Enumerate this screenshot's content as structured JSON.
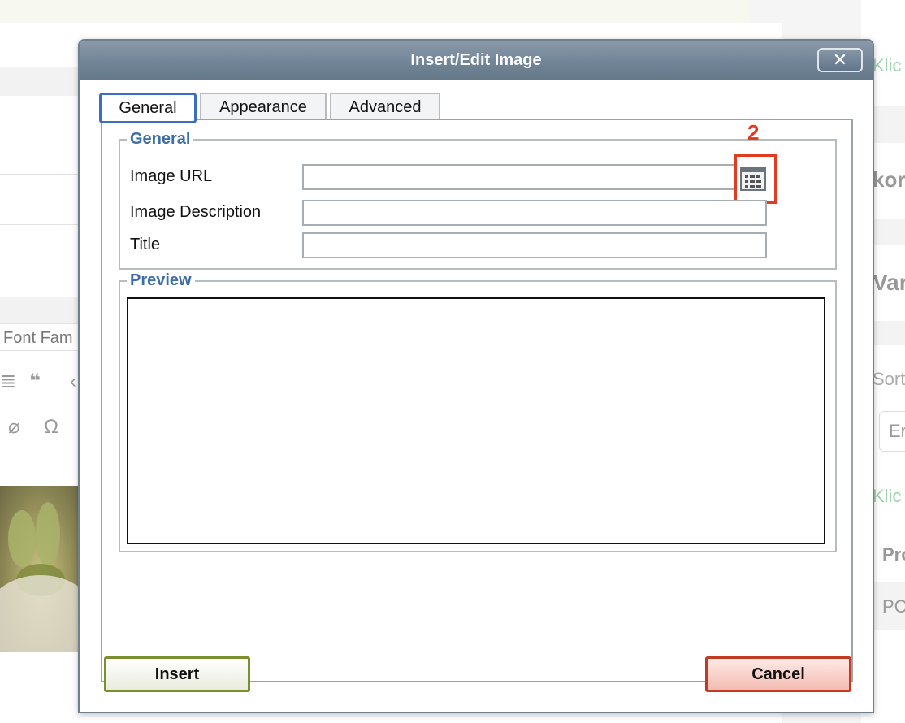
{
  "background": {
    "toolbar_font_label": "Font Fam",
    "right_texts": [
      "Klic",
      "kor",
      "Vare",
      "Sort",
      "Er",
      "Klic",
      "Pro",
      "PC"
    ]
  },
  "dialog": {
    "title": "Insert/Edit Image",
    "close_label": "✕",
    "tabs": [
      "General",
      "Appearance",
      "Advanced"
    ],
    "general_legend": "General",
    "fields": [
      {
        "label": "Image URL",
        "value": "",
        "placeholder": ""
      },
      {
        "label": "Image Description",
        "value": "",
        "placeholder": ""
      },
      {
        "label": "Title",
        "value": "",
        "placeholder": ""
      }
    ],
    "browse_icon": "browse-list-icon",
    "preview_legend": "Preview",
    "annotation_number": "2",
    "insert_label": "Insert",
    "cancel_label": "Cancel"
  },
  "colors": {
    "legend_blue": "#3d6ea9",
    "annotation_red": "#e23b1f",
    "titlebar": "#74879a",
    "active_tab_border": "#3b6ec2",
    "insert_border": "#7a8f2e",
    "cancel_border": "#c23a22"
  }
}
